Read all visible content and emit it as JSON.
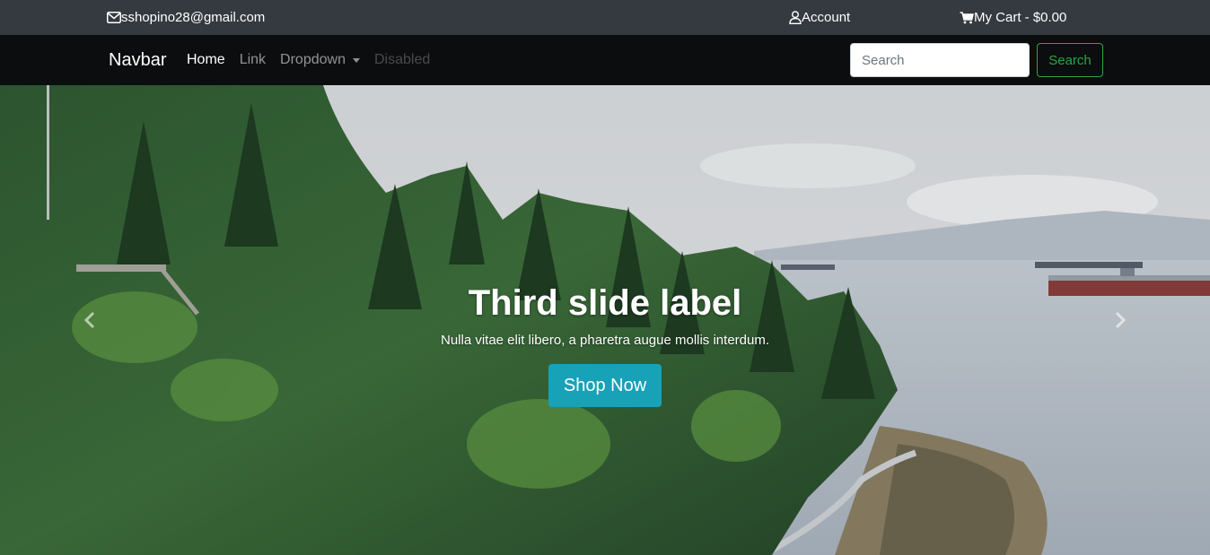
{
  "topbar": {
    "email": "sshopino28@gmail.com",
    "account": "Account",
    "cart": "My Cart - $0.00",
    "icons": [
      "envelope-icon",
      "user-icon",
      "cart-icon"
    ]
  },
  "navbar": {
    "brand": "Navbar",
    "links": [
      {
        "label": "Home",
        "state": "active"
      },
      {
        "label": "Link",
        "state": "normal"
      },
      {
        "label": "Dropdown",
        "state": "dropdown"
      },
      {
        "label": "Disabled",
        "state": "disabled"
      }
    ],
    "search_placeholder": "Search",
    "search_button": "Search"
  },
  "carousel": {
    "title": "Third slide label",
    "text": "Nulla vitae elit libero, a pharetra augue mollis interdum.",
    "button": "Shop Now",
    "prev_icon": "chevron-left-icon",
    "next_icon": "chevron-right-icon"
  },
  "colors": {
    "topbar_bg": "#343a40",
    "navbar_bg": "#0c0d0e",
    "search_accent": "#28a745",
    "shop_button": "#17a2b8"
  }
}
